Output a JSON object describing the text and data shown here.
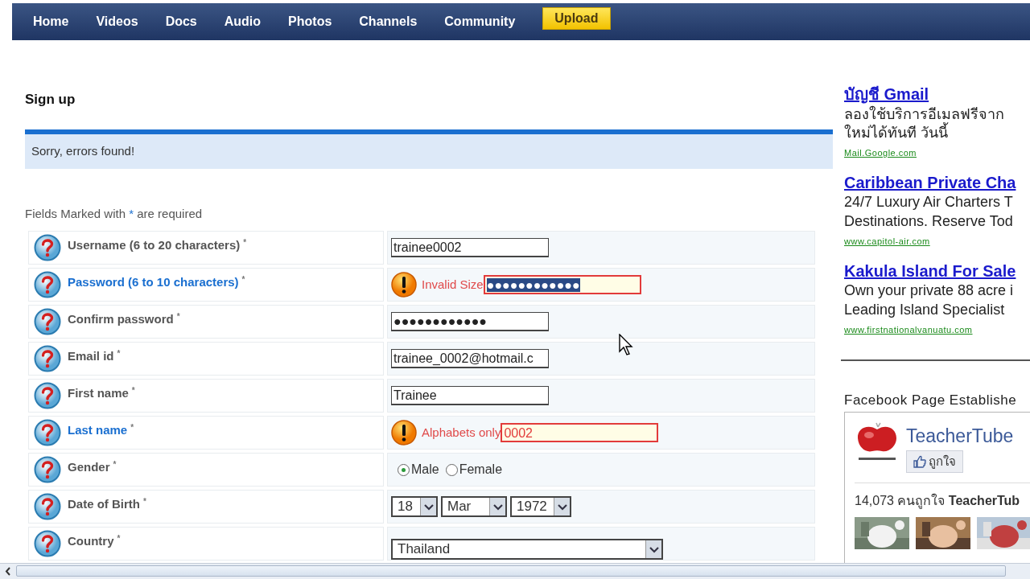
{
  "nav": {
    "items": [
      "Home",
      "Videos",
      "Docs",
      "Audio",
      "Photos",
      "Channels",
      "Community"
    ],
    "upload": "Upload"
  },
  "form": {
    "title": "Sign up",
    "error_banner": "Sorry, errors found!",
    "note_before": "Fields Marked with",
    "note_mark": "*",
    "note_after": "are required",
    "rows": [
      {
        "label": "Username (6 to 20 characters)",
        "mark": "*",
        "error": false,
        "kind": "text",
        "value": "trainee0002"
      },
      {
        "label": "Password (6 to 10 characters)",
        "mark": "*",
        "error": true,
        "message": "Invalid Size",
        "kind": "text",
        "value": "●●●●●●●●●●●●",
        "selected": true
      },
      {
        "label": "Confirm password",
        "mark": "*",
        "error": false,
        "kind": "text",
        "value": "●●●●●●●●●●●●"
      },
      {
        "label": "Email id",
        "mark": "*",
        "error": false,
        "kind": "text",
        "value": "trainee_0002@hotmail.c"
      },
      {
        "label": "First name",
        "mark": "*",
        "error": false,
        "kind": "text",
        "value": "Trainee"
      },
      {
        "label": "Last name",
        "mark": "*",
        "error": true,
        "message": "Alphabets only",
        "kind": "text",
        "value": "0002",
        "selected": false
      },
      {
        "label": "Gender",
        "mark": "*",
        "error": false,
        "kind": "radio",
        "options": [
          {
            "label": "Male",
            "selected": true
          },
          {
            "label": "Female",
            "selected": false
          }
        ]
      },
      {
        "label": "Date of Birth",
        "mark": "*",
        "error": false,
        "kind": "date",
        "parts": [
          "18",
          "Mar",
          "1972"
        ]
      },
      {
        "label": "Country",
        "mark": "*",
        "error": false,
        "kind": "select",
        "value": "Thailand"
      }
    ]
  },
  "ads": [
    {
      "title": "บัญชี Gmail",
      "lines": [
        "ลองใช้บริการอีเมลฟรีจาก",
        "ใหม่ได้ทันที วันนี้"
      ],
      "url": "Mail.Google.com"
    },
    {
      "title": "Caribbean Private Cha",
      "lines": [
        "24/7 Luxury Air Charters T",
        "Destinations. Reserve Tod"
      ],
      "url": "www.capitol-air.com"
    },
    {
      "title": "Kakula Island For Sale",
      "lines": [
        "Own your private 88 acre i",
        "Leading Island Specialist"
      ],
      "url": "www.firstnationalvanuatu.com"
    }
  ],
  "facebook": {
    "heading": "Facebook Page Establishe",
    "page_name": "TeacherTube",
    "like": "ถูกใจ",
    "count": "14,073 คนถูกใจ **TeacherTub**"
  }
}
